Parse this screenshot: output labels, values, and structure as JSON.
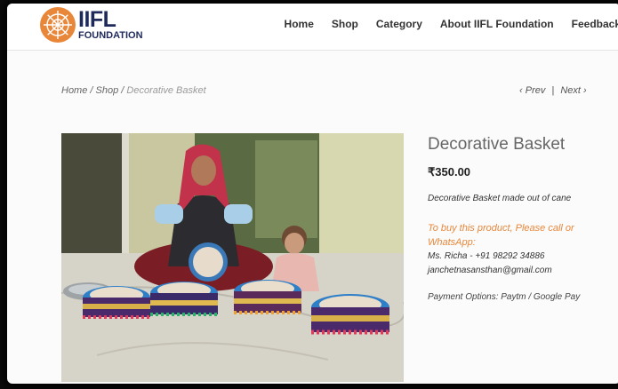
{
  "brand": {
    "main": "IIFL",
    "sub": "FOUNDATION"
  },
  "nav": [
    "Home",
    "Shop",
    "Category",
    "About IIFL Foundation",
    "Feedback"
  ],
  "breadcrumb": {
    "home": "Home",
    "sep1": " / ",
    "shop": "Shop",
    "sep2": " / ",
    "current": "Decorative Basket"
  },
  "pager": {
    "prev": "Prev",
    "divider": "|",
    "next": "Next"
  },
  "product": {
    "title": "Decorative Basket",
    "price": "₹350.00",
    "description": "Decorative Basket made out of cane",
    "callout_line1": "To buy this product, Please call or",
    "callout_line2": "WhatsApp:",
    "contact_name": "Ms. Richa - +91 98292 34886",
    "contact_email": "janchetnasansthan@gmail.com",
    "payment": "Payment Options: Paytm / Google Pay"
  },
  "colors": {
    "brand_navy": "#1f2a5c",
    "brand_orange": "#e8873a",
    "basket_blue": "#2f7fc8"
  }
}
